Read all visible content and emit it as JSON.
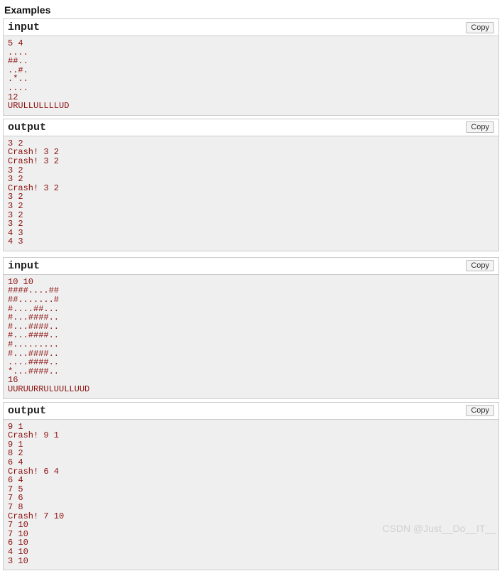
{
  "title": "Examples",
  "copy_label": "Copy",
  "watermark": "CSDN @Just__Do__IT__",
  "examples": [
    {
      "input_label": "input",
      "input_text": "5 4\n....\n##..\n..#.\n.*..\n....\n12\nURULLULLLLUD",
      "output_label": "output",
      "output_text": "3 2\nCrash! 3 2\nCrash! 3 2\n3 2\n3 2\nCrash! 3 2\n3 2\n3 2\n3 2\n3 2\n4 3\n4 3"
    },
    {
      "input_label": "input",
      "input_text": "10 10\n####....##\n##.......#\n#....##...\n#...####..\n#...####..\n#...####..\n#.........\n#...####..\n....####..\n*...####..\n16\nUURUURRULUULLUUD",
      "output_label": "output",
      "output_text": "9 1\nCrash! 9 1\n9 1\n8 2\n6 4\nCrash! 6 4\n6 4\n7 5\n7 6\n7 8\nCrash! 7 10\n7 10\n7 10\n6 10\n4 10\n3 10"
    }
  ]
}
